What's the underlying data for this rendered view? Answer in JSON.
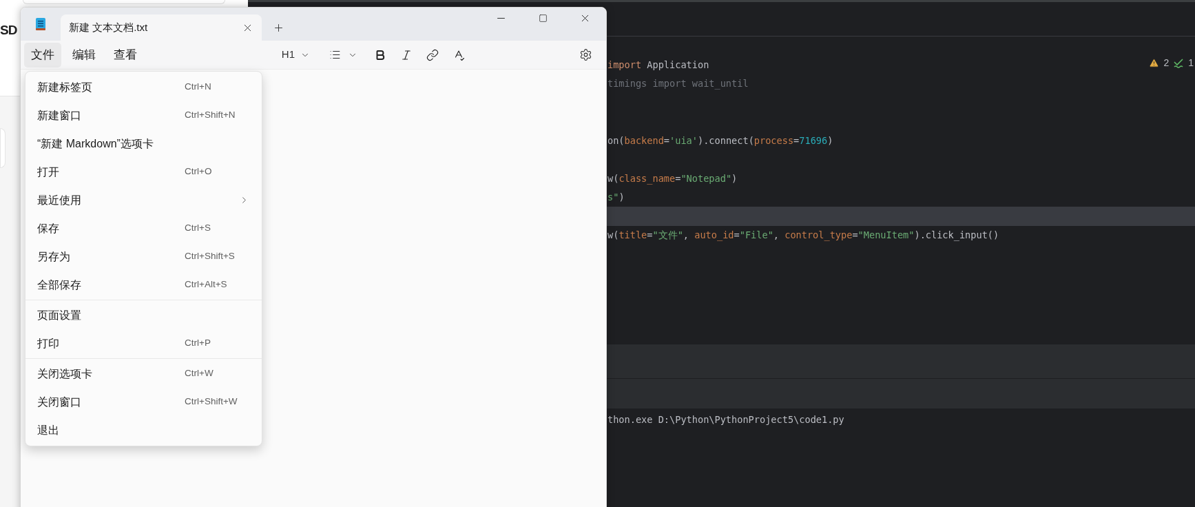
{
  "background_page": {
    "heading": "SD"
  },
  "notepad": {
    "tabs": [
      {
        "title": "新建 文本文档.txt",
        "selected": true
      }
    ],
    "menu_bar": [
      {
        "label": "文件",
        "selected": true
      },
      {
        "label": "编辑",
        "selected": false
      },
      {
        "label": "查看",
        "selected": false
      }
    ],
    "toolbar": {
      "heading_button": "H1"
    },
    "file_menu": {
      "sections": [
        {
          "items": [
            {
              "kind": "item",
              "label": "新建标签页",
              "shortcut": "Ctrl+N"
            },
            {
              "kind": "item",
              "label": "新建窗口",
              "shortcut": "Ctrl+Shift+N"
            },
            {
              "kind": "item",
              "label": "“新建 Markdown”选项卡"
            },
            {
              "kind": "item",
              "label": "打开",
              "shortcut": "Ctrl+O"
            },
            {
              "kind": "submenu",
              "label": "最近使用"
            },
            {
              "kind": "item",
              "label": "保存",
              "shortcut": "Ctrl+S"
            },
            {
              "kind": "item",
              "label": "另存为",
              "shortcut": "Ctrl+Shift+S"
            },
            {
              "kind": "item",
              "label": "全部保存",
              "shortcut": "Ctrl+Alt+S"
            }
          ]
        },
        {
          "items": [
            {
              "kind": "item",
              "label": "页面设置"
            },
            {
              "kind": "item",
              "label": "打印",
              "shortcut": "Ctrl+P"
            }
          ]
        },
        {
          "items": [
            {
              "kind": "item",
              "label": "关闭选项卡",
              "shortcut": "Ctrl+W"
            },
            {
              "kind": "item",
              "label": "关闭窗口",
              "shortcut": "Ctrl+Shift+W"
            },
            {
              "kind": "item",
              "label": "退出"
            }
          ]
        }
      ]
    }
  },
  "ide": {
    "inspections": {
      "warnings": "2",
      "checks": "1"
    },
    "code_lines": [
      {
        "current": false,
        "tokens": [
          {
            "kind": "keyword",
            "text": "import"
          },
          {
            "kind": "plain",
            "text": " Application"
          }
        ]
      },
      {
        "current": false,
        "tokens": [
          {
            "kind": "dim",
            "text": "timings import wait_until"
          }
        ]
      },
      {
        "current": false
      },
      {
        "current": false
      },
      {
        "current": false,
        "tokens": [
          {
            "kind": "plain",
            "text": "on("
          },
          {
            "kind": "param",
            "text": "backend"
          },
          {
            "kind": "plain",
            "text": "="
          },
          {
            "kind": "string",
            "text": "'uia'"
          },
          {
            "kind": "plain",
            "text": ").connect("
          },
          {
            "kind": "param",
            "text": "process"
          },
          {
            "kind": "plain",
            "text": "="
          },
          {
            "kind": "number",
            "text": "71696"
          },
          {
            "kind": "plain",
            "text": ")"
          }
        ]
      },
      {
        "current": false
      },
      {
        "current": false,
        "tokens": [
          {
            "kind": "plain",
            "text": "w("
          },
          {
            "kind": "param",
            "text": "class_name"
          },
          {
            "kind": "plain",
            "text": "="
          },
          {
            "kind": "string",
            "text": "\"Notepad\""
          },
          {
            "kind": "plain",
            "text": ")"
          }
        ]
      },
      {
        "current": false,
        "tokens": [
          {
            "kind": "string",
            "text": "s\""
          },
          {
            "kind": "plain",
            "text": ")"
          }
        ]
      },
      {
        "current": true
      },
      {
        "current": false,
        "tokens": [
          {
            "kind": "plain",
            "text": "w("
          },
          {
            "kind": "param",
            "text": "title"
          },
          {
            "kind": "plain",
            "text": "="
          },
          {
            "kind": "string",
            "text": "\"文件\""
          },
          {
            "kind": "plain",
            "text": ", "
          },
          {
            "kind": "param",
            "text": "auto_id"
          },
          {
            "kind": "plain",
            "text": "="
          },
          {
            "kind": "string",
            "text": "\"File\""
          },
          {
            "kind": "plain",
            "text": ", "
          },
          {
            "kind": "param",
            "text": "control_type"
          },
          {
            "kind": "plain",
            "text": "="
          },
          {
            "kind": "string",
            "text": "\"MenuItem\""
          },
          {
            "kind": "plain",
            "text": ").click_input()"
          }
        ]
      }
    ],
    "console": {
      "lines": [
        "thon.exe D:\\Python\\PythonProject5\\code1.py"
      ]
    }
  }
}
